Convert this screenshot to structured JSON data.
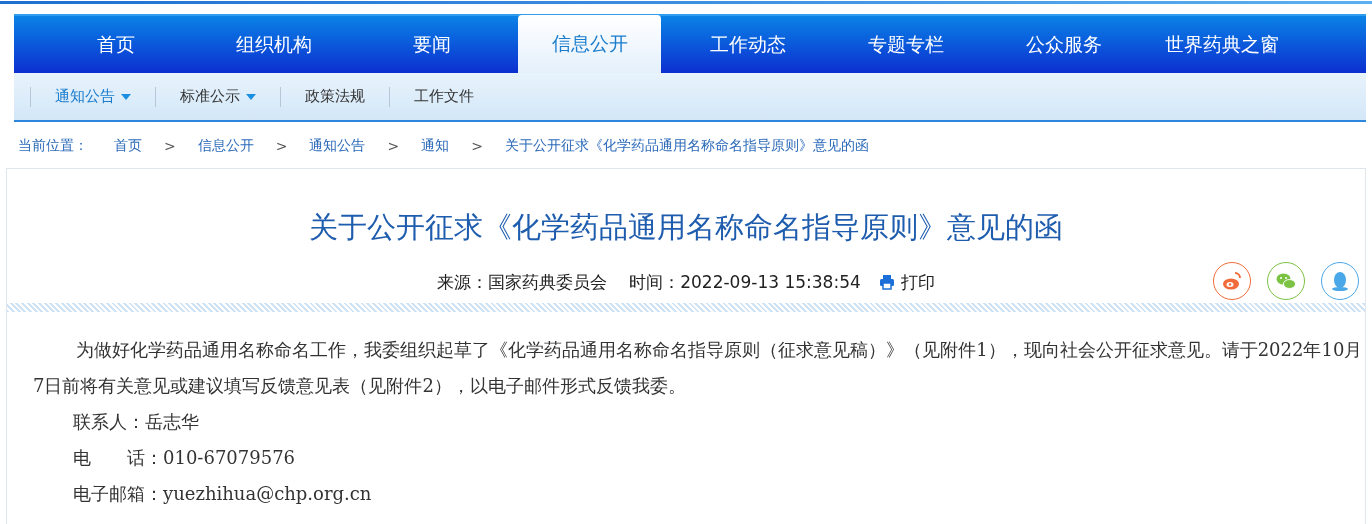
{
  "nav": [
    {
      "label": "首页",
      "selected": false
    },
    {
      "label": "组织机构",
      "selected": false
    },
    {
      "label": "要闻",
      "selected": false
    },
    {
      "label": "信息公开",
      "selected": true
    },
    {
      "label": "工作动态",
      "selected": false
    },
    {
      "label": "专题专栏",
      "selected": false
    },
    {
      "label": "公众服务",
      "selected": false
    },
    {
      "label": "世界药典之窗",
      "selected": false
    }
  ],
  "subnav": [
    {
      "label": "通知公告",
      "selected": true,
      "dropdown": true
    },
    {
      "label": "标准公示",
      "selected": false,
      "dropdown": true
    },
    {
      "label": "政策法规",
      "selected": false,
      "dropdown": false
    },
    {
      "label": "工作文件",
      "selected": false,
      "dropdown": false
    }
  ],
  "breadcrumb": {
    "label": "当前位置：",
    "items": [
      "首页",
      "信息公开",
      "通知公告",
      "通知",
      "关于公开征求《化学药品通用名称命名指导原则》意见的函"
    ],
    "separator": ">"
  },
  "article": {
    "title": "关于公开征求《化学药品通用名称命名指导原则》意见的函",
    "source": "来源：国家药典委员会",
    "time": "时间：2022-09-13 15:38:54",
    "print": "打印",
    "share": [
      {
        "kind": "weibo",
        "color": "#f26b3a"
      },
      {
        "kind": "wechat",
        "color": "#7cc243"
      },
      {
        "kind": "qq",
        "color": "#4aa8e8"
      }
    ],
    "paragraphs": [
      {
        "kind": "indent",
        "text": "为做好化学药品通用名称命名工作，我委组织起草了《化学药品通用名称命名指导原则（征求意见稿）》（见附件1），现向社会公开征求意见。请于2022年10月7日前将有关意见或建议填写反馈意见表（见附件2），以电子邮件形式反馈我委。"
      },
      {
        "kind": "contact",
        "text": "联系人：岳志华"
      },
      {
        "kind": "contact",
        "text": "电　　话：010-67079576"
      },
      {
        "kind": "contact",
        "text": "电子邮箱：yuezhihua@chp.org.cn"
      }
    ]
  }
}
